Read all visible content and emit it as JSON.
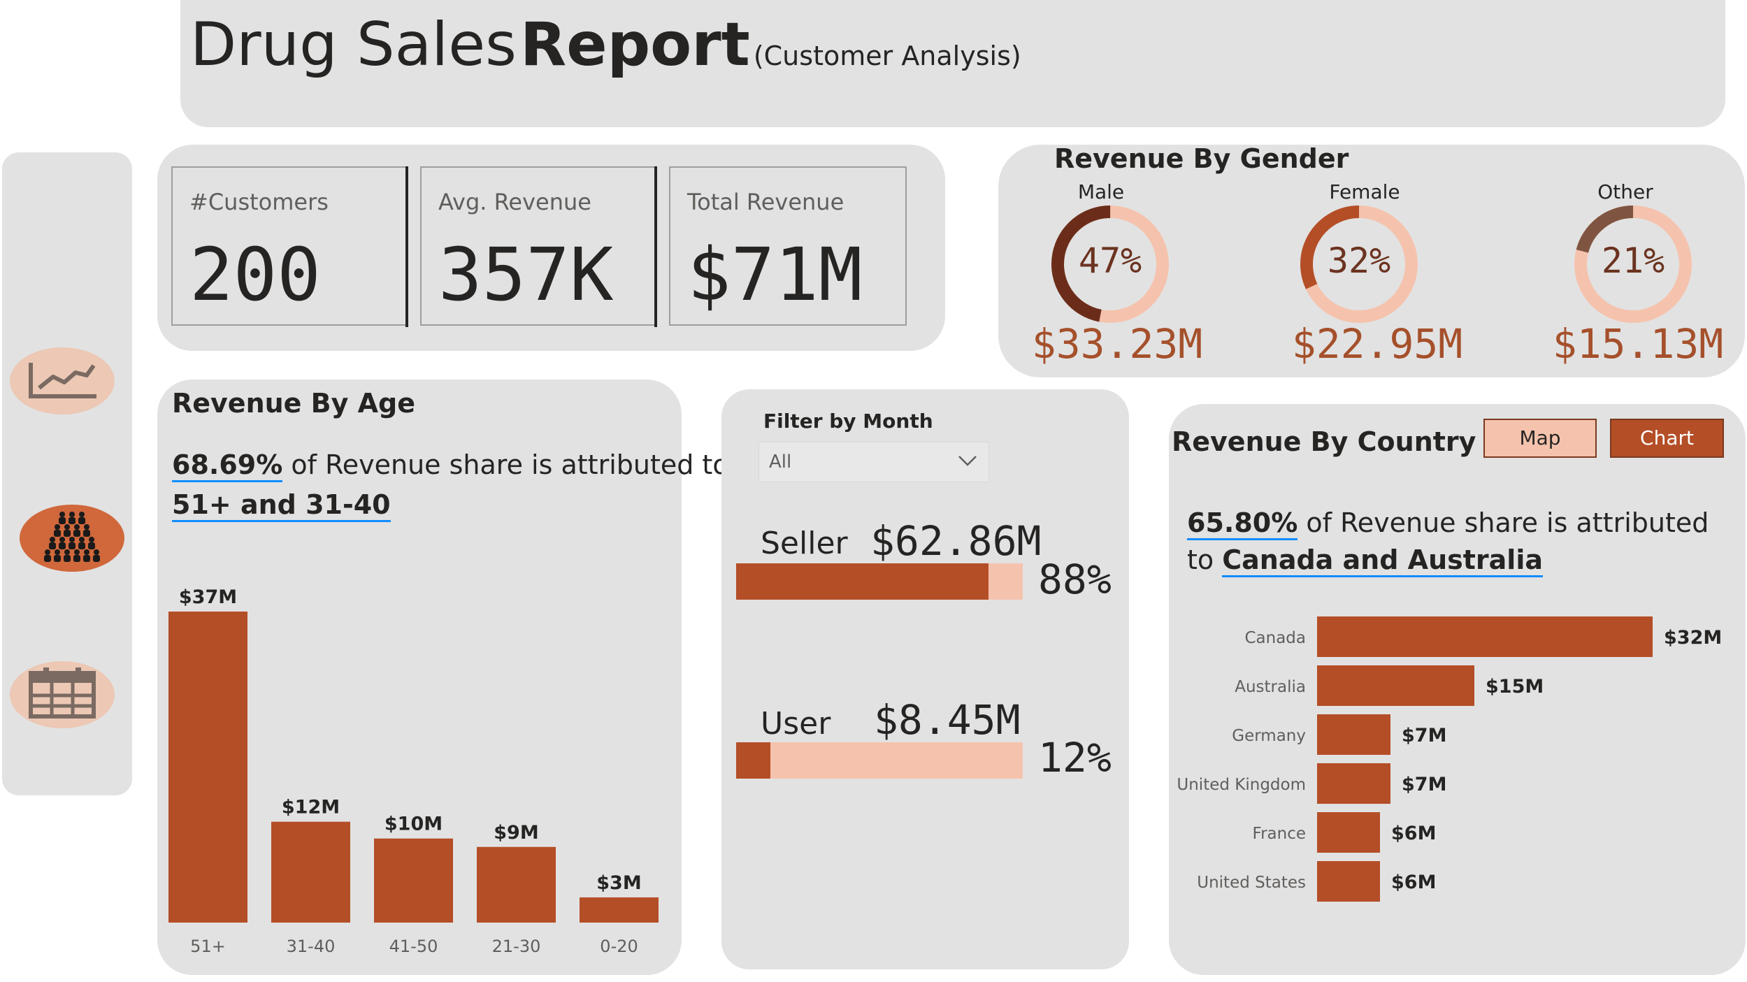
{
  "header": {
    "title_light": "Drug Sales",
    "title_bold": "Report",
    "subtitle": "(Customer Analysis)"
  },
  "nav": {
    "items": [
      {
        "icon": "line-chart-icon",
        "active": false
      },
      {
        "icon": "customers-icon",
        "active": true
      },
      {
        "icon": "calendar-icon",
        "active": false
      }
    ]
  },
  "kpis": [
    {
      "label": "#Customers",
      "value": "200"
    },
    {
      "label": "Avg. Revenue",
      "value": "357K"
    },
    {
      "label": "Total Revenue",
      "value": "$71M"
    }
  ],
  "gender": {
    "title": "Revenue By Gender",
    "items": [
      {
        "label": "Male",
        "percent": 47,
        "percent_label": "47%",
        "value": "$33.23M",
        "color": "#6b2d1a"
      },
      {
        "label": "Female",
        "percent": 32,
        "percent_label": "32%",
        "value": "$22.95M",
        "color": "#b44e27"
      },
      {
        "label": "Other",
        "percent": 21,
        "percent_label": "21%",
        "value": "$15.13M",
        "color": "#7f5440"
      }
    ],
    "track_color": "#f5c3ad"
  },
  "age": {
    "title": "Revenue By Age",
    "insight_pct": "68.69%",
    "insight_text": " of Revenue share is attributed to",
    "insight_groups": "51+ and 31-40"
  },
  "filter": {
    "label": "Filter by Month",
    "value": "All"
  },
  "seller_user": [
    {
      "label": "Seller",
      "value": "$62.86M",
      "percent": 88,
      "percent_label": "88%"
    },
    {
      "label": "User",
      "value": "$8.45M",
      "percent": 12,
      "percent_label": "12%"
    }
  ],
  "country": {
    "title": "Revenue By Country",
    "toggle_map": "Map",
    "toggle_chart": "Chart",
    "insight_pct": "65.80%",
    "insight_text": " of Revenue share is attributed",
    "insight_to": "to ",
    "insight_groups": "Canada and Australia"
  },
  "colors": {
    "bar": "#b44e27",
    "accent_light": "#f5c3ad",
    "panel": "#e2e2e2"
  },
  "chart_data": [
    {
      "type": "bar",
      "title": "Revenue By Age",
      "categories": [
        "51+",
        "31-40",
        "41-50",
        "21-30",
        "0-20"
      ],
      "values": [
        37,
        12,
        10,
        9,
        3
      ],
      "data_labels": [
        "$37M",
        "$12M",
        "$10M",
        "$9M",
        "$3M"
      ],
      "unit": "$M",
      "ylim": [
        0,
        37
      ]
    },
    {
      "type": "bar",
      "orientation": "horizontal",
      "title": "Revenue By Country",
      "categories": [
        "Canada",
        "Australia",
        "Germany",
        "United Kingdom",
        "France",
        "United States"
      ],
      "values": [
        32,
        15,
        7,
        7,
        6,
        6
      ],
      "data_labels": [
        "$32M",
        "$15M",
        "$7M",
        "$7M",
        "$6M",
        "$6M"
      ],
      "unit": "$M",
      "xlim": [
        0,
        32
      ]
    }
  ]
}
